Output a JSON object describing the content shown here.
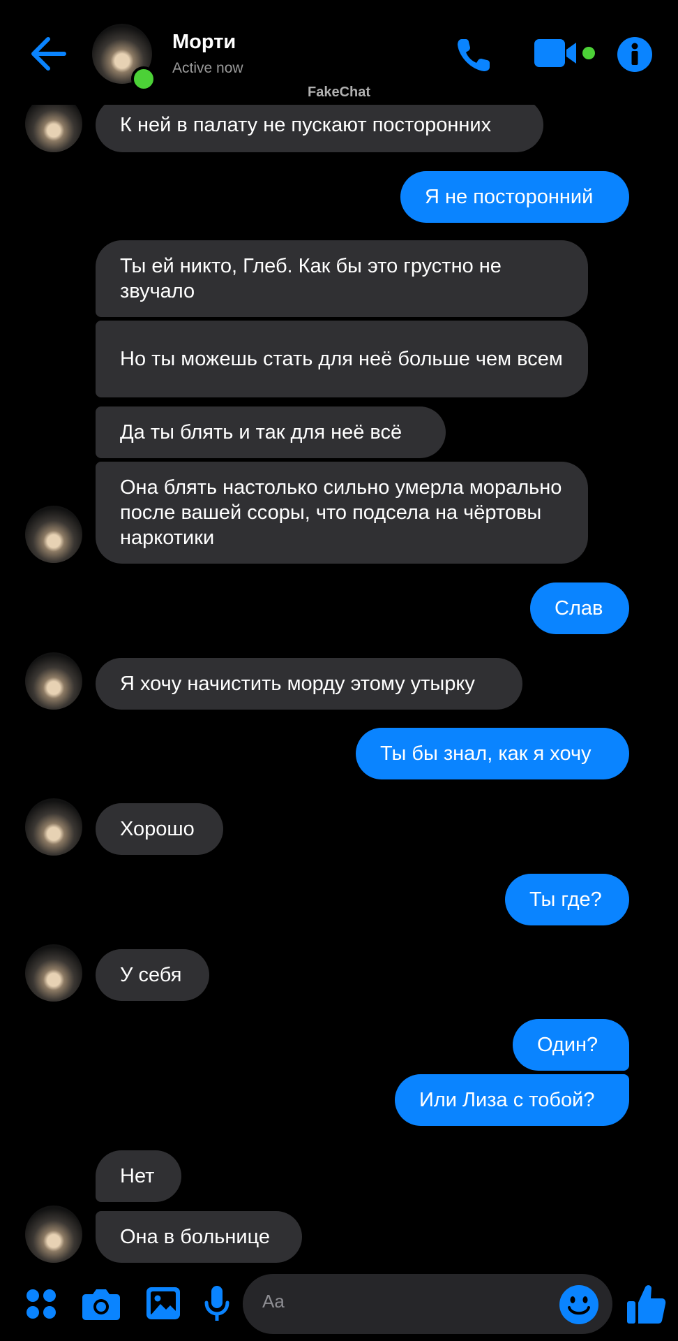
{
  "header": {
    "contact_name": "Морти",
    "status": "Active now",
    "watermark": "FakeChat",
    "icons": [
      "back-arrow-icon",
      "phone-icon",
      "video-camera-icon",
      "info-icon"
    ],
    "accent_color": "#0a84ff",
    "online_color": "#4cd137"
  },
  "messages": [
    {
      "side": "in",
      "text": "К ней в палату не пускают посторонних"
    },
    {
      "side": "out",
      "text": "Я не посторонний"
    },
    {
      "side": "in",
      "text": "Ты ей никто, Глеб. Как бы это грустно не звучало"
    },
    {
      "side": "in",
      "text": "Но ты можешь стать для неё больше чем всем"
    },
    {
      "side": "in",
      "text": "Да ты блять и так для неё всё"
    },
    {
      "side": "in",
      "text": "Она блять настолько сильно умерла морально после вашей ссоры, что подсела на чёртовы наркотики"
    },
    {
      "side": "out",
      "text": "Слав"
    },
    {
      "side": "in",
      "text": "Я хочу начистить морду этому утырку"
    },
    {
      "side": "out",
      "text": "Ты бы знал, как я хочу"
    },
    {
      "side": "in",
      "text": "Хорошо"
    },
    {
      "side": "out",
      "text": "Ты где?"
    },
    {
      "side": "in",
      "text": "У себя"
    },
    {
      "side": "out",
      "text": "Один?"
    },
    {
      "side": "out",
      "text": "Или Лиза с тобой?"
    },
    {
      "side": "in",
      "text": "Нет"
    },
    {
      "side": "in",
      "text": "Она в больнице"
    }
  ],
  "composer": {
    "placeholder": "Aa",
    "icons": [
      "apps-grid-icon",
      "camera-icon",
      "gallery-icon",
      "microphone-icon",
      "emoji-icon",
      "thumbs-up-icon"
    ]
  }
}
